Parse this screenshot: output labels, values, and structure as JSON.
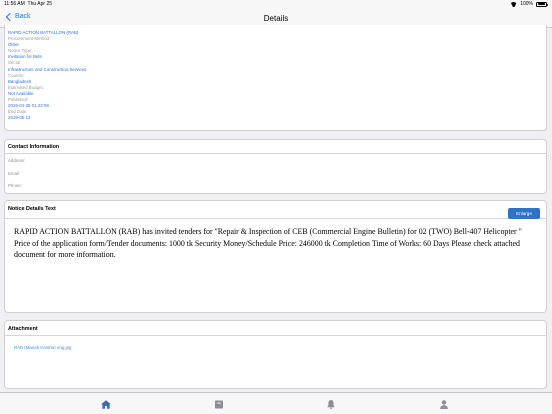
{
  "status_bar": {
    "time": "11:56 AM",
    "date": "Thu Apr 25",
    "battery": "100%",
    "battery_fill": 1.0
  },
  "nav": {
    "back_label": "Back",
    "title": "Details"
  },
  "info": {
    "lines": [
      {
        "kind": "value",
        "text": "RAPID ACTION BATTALLON (RAB)"
      },
      {
        "kind": "label",
        "text": "Procurement Method:"
      },
      {
        "kind": "value",
        "text": "Other"
      },
      {
        "kind": "label",
        "text": "Notice Type:"
      },
      {
        "kind": "value",
        "text": "Invitation for Bids"
      },
      {
        "kind": "label",
        "text": "Sector:"
      },
      {
        "kind": "value",
        "text": "Infrastructure and Construction,Services"
      },
      {
        "kind": "label",
        "text": "Country:"
      },
      {
        "kind": "value",
        "text": "Bangladesh"
      },
      {
        "kind": "label",
        "text": "Estimated Budget:"
      },
      {
        "kind": "value",
        "text": "Not Available"
      },
      {
        "kind": "label",
        "text": "Published:"
      },
      {
        "kind": "value",
        "text": "2019-04-25 01:42:09"
      },
      {
        "kind": "label",
        "text": "End Date:"
      },
      {
        "kind": "value",
        "text": "2019-05-13"
      }
    ]
  },
  "contact": {
    "title": "Contact Information",
    "address_label": "Address:",
    "email_label": "Email:",
    "phone_label": "Phone:"
  },
  "notice": {
    "title": "Notice Details Text",
    "enlarge_label": "Enlarge",
    "text": "RAPID ACTION BATTALLON (RAB) has invited tenders for \"Repair & Inspection of CEB (Commercial Engine Bulletin) for 02 (TWO) Bell-407 Helicopter \" Price of the application form/Tender documents: 1000 tk Security Money/Schedule Price: 246000 tk Completion Time of Works: 60 Days Please check attached document for more information."
  },
  "attachment": {
    "title": "Attachment",
    "file": "RAB (Manab Kantha) eng.jpg"
  },
  "tabs": [
    {
      "id": "home",
      "icon": "home-icon",
      "active": true
    },
    {
      "id": "saved",
      "icon": "archive-icon",
      "active": false
    },
    {
      "id": "alerts",
      "icon": "bell-icon",
      "active": false
    },
    {
      "id": "profile",
      "icon": "person-icon",
      "active": false
    }
  ],
  "colors": {
    "accent": "#2d72e0",
    "button": "#2f73c6",
    "tab_active": "#3a6fb5",
    "tab_inactive": "#8e8e93"
  }
}
